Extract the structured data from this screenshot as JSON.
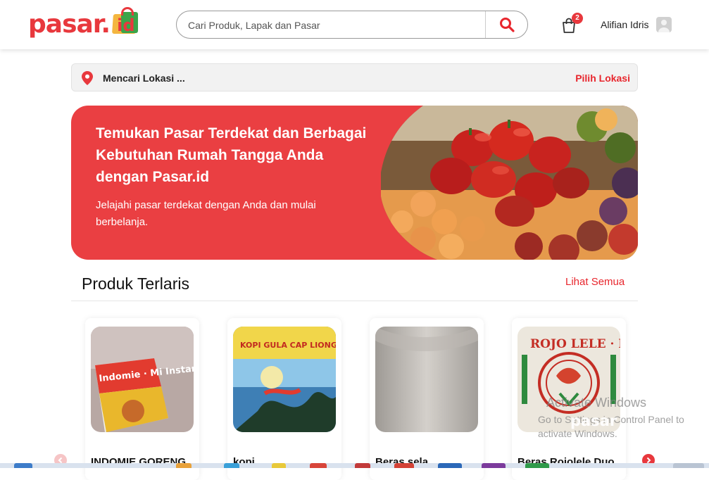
{
  "header": {
    "logo_text": "pasar.",
    "logo_suffix": "id",
    "search_placeholder": "Cari Produk, Lapak dan Pasar",
    "cart_count": "2",
    "user_name": "Alifian Idris"
  },
  "location": {
    "status_text": "Mencari Lokasi ...",
    "pick_label": "Pilih Lokasi"
  },
  "hero": {
    "title": "Temukan Pasar Terdekat dan Berbagai Kebutuhan Rumah Tangga Anda dengan Pasar.id",
    "subtitle": "Jelajahi pasar terdekat dengan Anda dan mulai berbelanja."
  },
  "best_sellers": {
    "title": "Produk Terlaris",
    "see_all": "Lihat Semua",
    "products": [
      {
        "name": "INDOMIE GORENG",
        "image_text": "Indomie · Mi Instan · Mi Goreng"
      },
      {
        "name": "kopi",
        "image_text": "KOPI GULA CAP LIONG BULAN"
      },
      {
        "name": "Beras sela",
        "image_text": ""
      },
      {
        "name": "Beras Rojolele Duo",
        "image_text": "ROJO LELE · DUA ROTI"
      }
    ]
  },
  "watermark": {
    "line1": "Activate Windows",
    "line2": "Go to Settings in Control Panel to activate Windows.",
    "brand": "pasar"
  },
  "colors": {
    "brand_red": "#e8383d",
    "hero_red": "#ea3f42",
    "logo_green": "#3aa54a",
    "logo_yellow": "#f4b63f"
  },
  "icons": {
    "search": "search-icon",
    "cart": "cart-icon",
    "avatar": "user-avatar-icon",
    "location": "location-pin-icon",
    "prev": "chevron-left-icon",
    "next": "chevron-right-icon"
  }
}
